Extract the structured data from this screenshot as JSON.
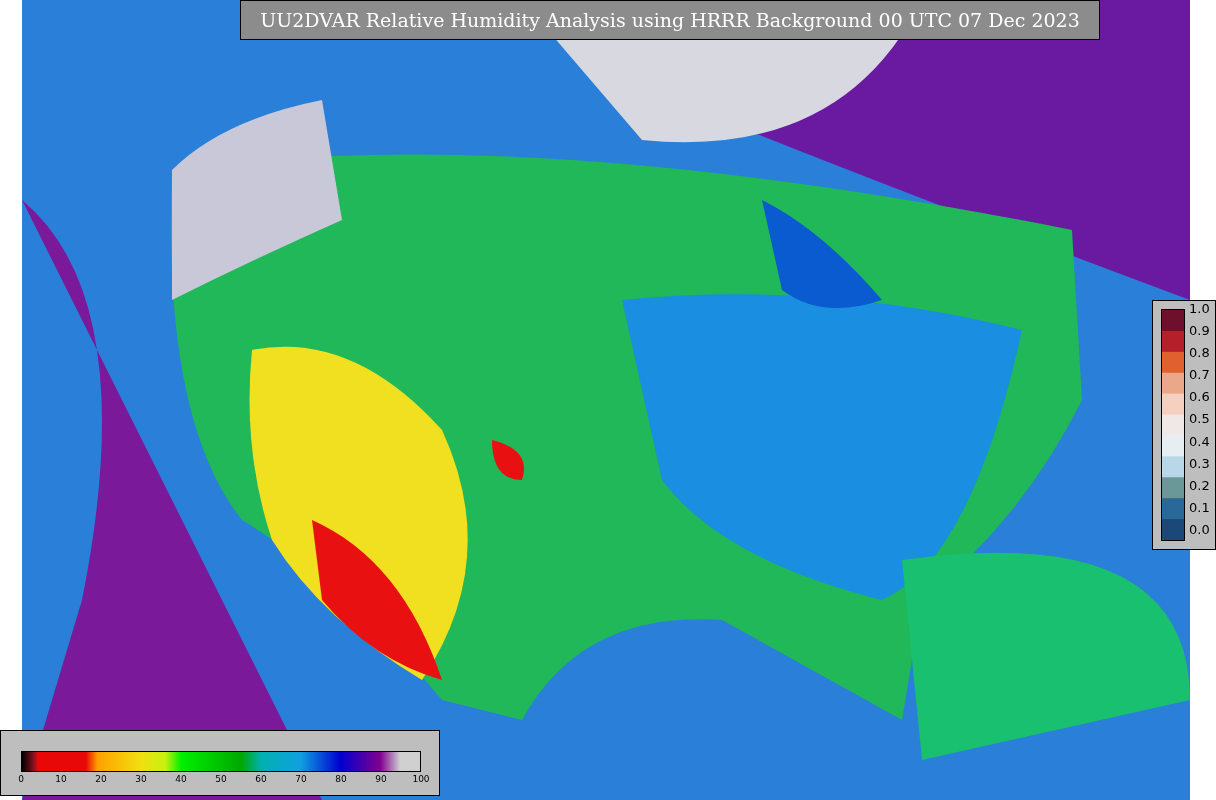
{
  "title": "UU2DVAR Relative Humidity Analysis using HRRR Background 00 UTC 07 Dec 2023",
  "humidity_colorbar": {
    "ticks": [
      "0",
      "10",
      "20",
      "30",
      "40",
      "50",
      "60",
      "70",
      "80",
      "90",
      "100"
    ]
  },
  "ratio_colorbar": {
    "ticks": [
      "1.0",
      "0.9",
      "0.8",
      "0.7",
      "0.6",
      "0.5",
      "0.4",
      "0.3",
      "0.2",
      "0.1",
      "0.0"
    ]
  }
}
